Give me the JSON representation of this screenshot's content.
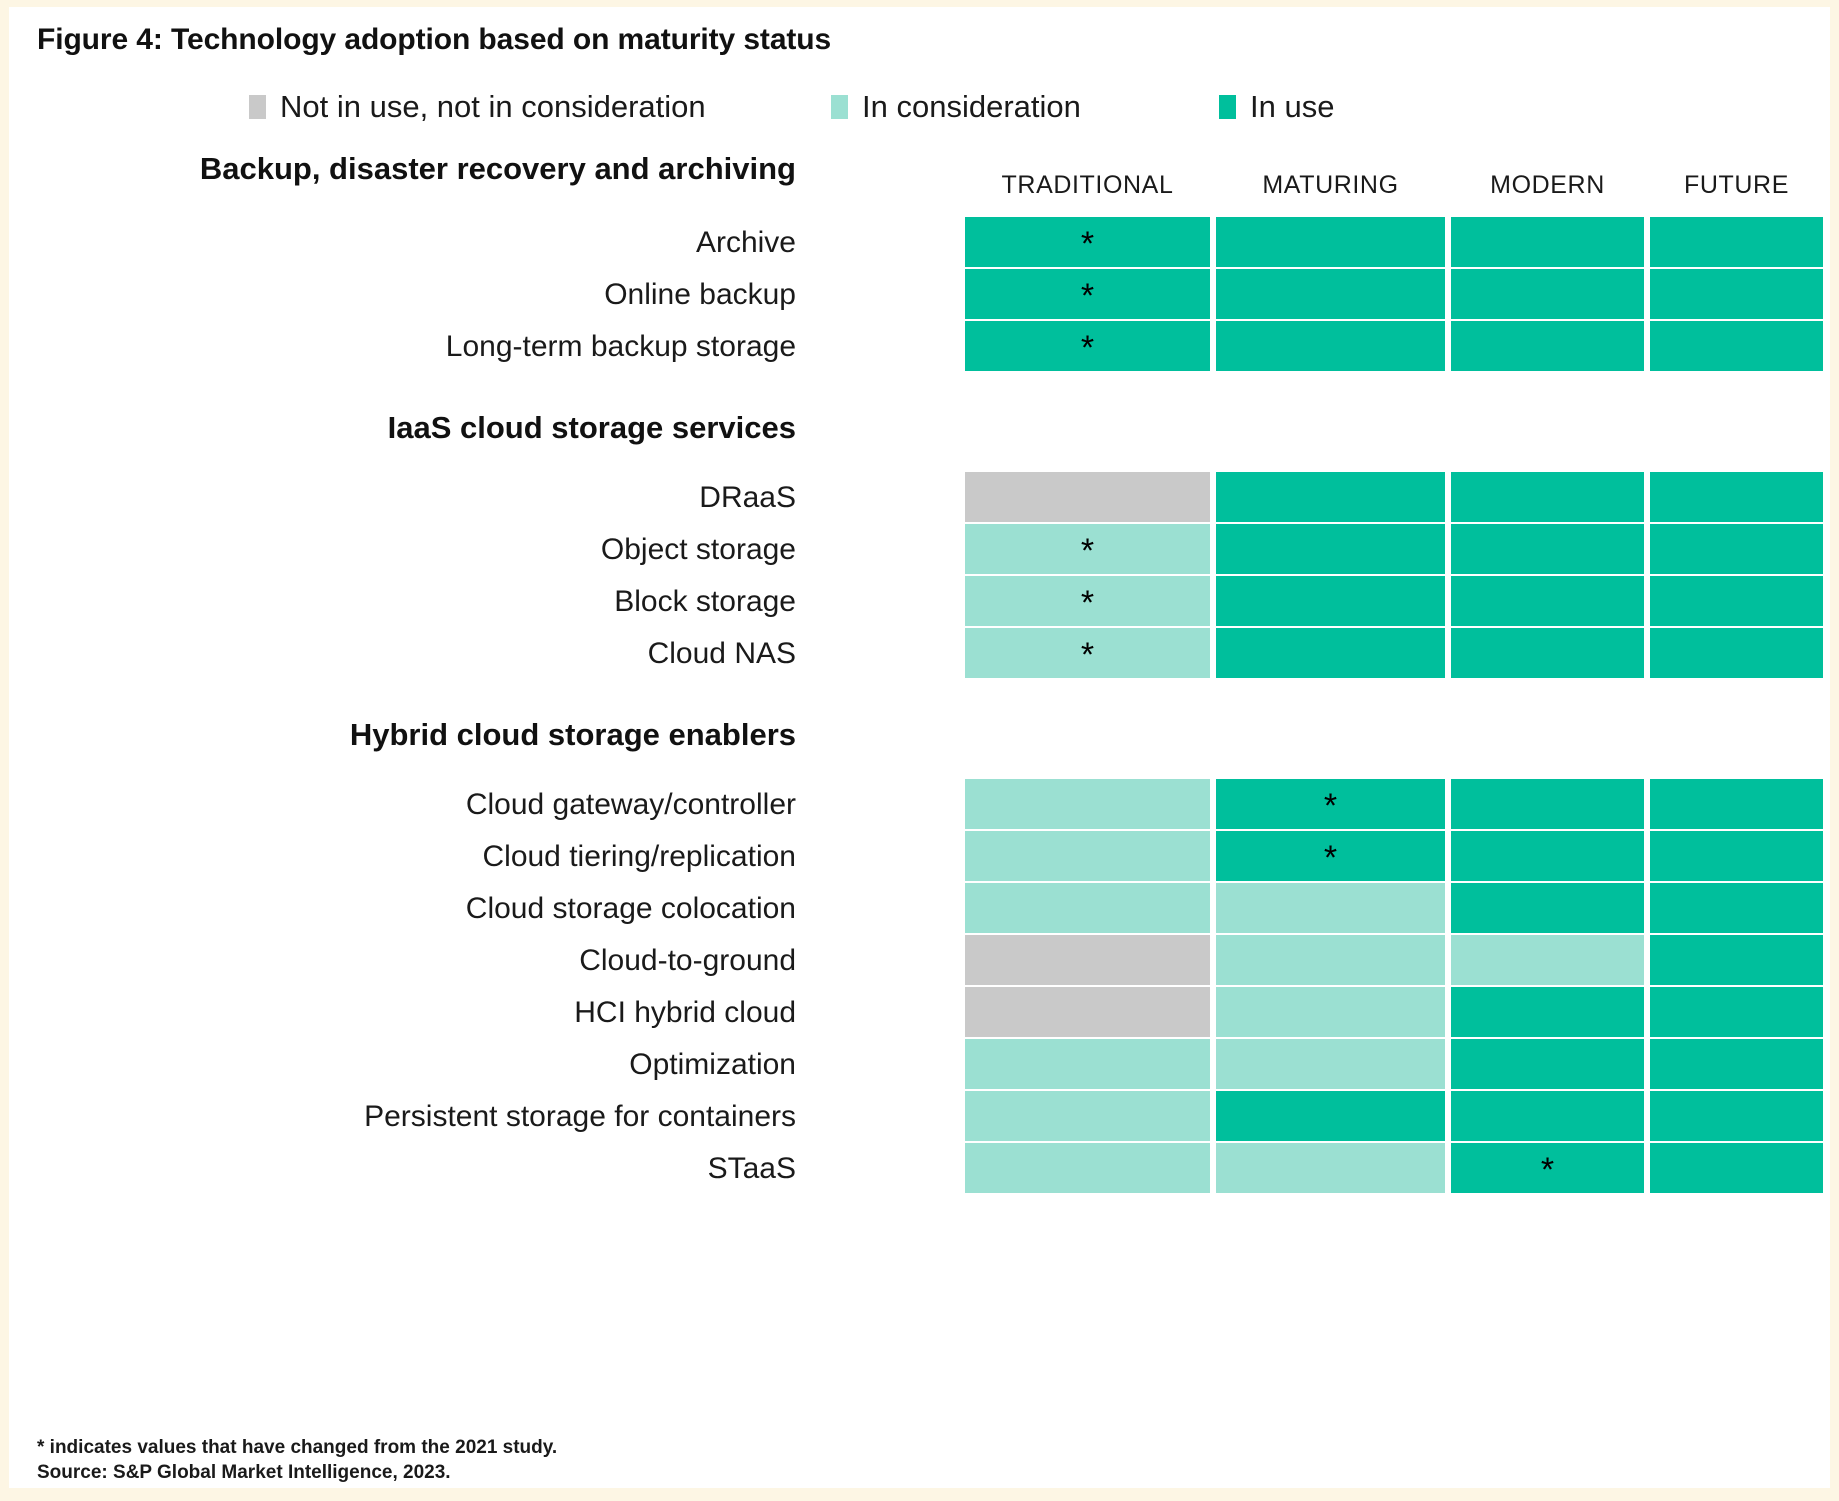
{
  "figure": {
    "title": "Figure 4: Technology adoption based on maturity status"
  },
  "colors": {
    "not_in_use": "#c9c9c9",
    "in_consideration": "#9be0d2",
    "in_use": "#00bf9c",
    "page_background": "#ffffff",
    "margin_background": "#fdf6e4",
    "text": "#1a1a1a"
  },
  "legend": {
    "items": [
      {
        "label": "Not in use, not in consideration",
        "color": "#c9c9c9",
        "key": "not_in_use"
      },
      {
        "label": "In consideration",
        "color": "#9be0d2",
        "key": "in_consideration"
      },
      {
        "label": "In use",
        "color": "#00bf9c",
        "key": "in_use"
      }
    ]
  },
  "columns": [
    {
      "label": "TRADITIONAL"
    },
    {
      "label": "MATURING"
    },
    {
      "label": "MODERN"
    },
    {
      "label": "FUTURE"
    }
  ],
  "footnote": {
    "line1": "* indicates values that have changed from the 2021 study.",
    "line2": "Source: S&P Global Market Intelligence, 2023."
  },
  "star_marker": "*",
  "chart_data": {
    "type": "heatmap",
    "title": "Figure 4: Technology adoption based on maturity status",
    "xlabel": "",
    "ylabel": "",
    "categories": [
      "TRADITIONAL",
      "MATURING",
      "MODERN",
      "FUTURE"
    ],
    "legend_position": "top",
    "value_scale": [
      "not_in_use",
      "in_consideration",
      "in_use"
    ],
    "value_colors": {
      "not_in_use": "#c9c9c9",
      "in_consideration": "#9be0d2",
      "in_use": "#00bf9c"
    },
    "annotation": "* indicates values that have changed from the 2021 study.",
    "source": "Source: S&P Global Market Intelligence, 2023.",
    "sections": [
      {
        "title": "Backup, disaster recovery and archiving",
        "rows": [
          {
            "label": "Archive",
            "values": [
              "in_use",
              "in_use",
              "in_use",
              "in_use"
            ],
            "stars": [
              true,
              false,
              false,
              false
            ]
          },
          {
            "label": "Online backup",
            "values": [
              "in_use",
              "in_use",
              "in_use",
              "in_use"
            ],
            "stars": [
              true,
              false,
              false,
              false
            ]
          },
          {
            "label": "Long-term backup storage",
            "values": [
              "in_use",
              "in_use",
              "in_use",
              "in_use"
            ],
            "stars": [
              true,
              false,
              false,
              false
            ]
          }
        ]
      },
      {
        "title": "IaaS cloud storage services",
        "rows": [
          {
            "label": "DRaaS",
            "values": [
              "not_in_use",
              "in_use",
              "in_use",
              "in_use"
            ],
            "stars": [
              false,
              false,
              false,
              false
            ]
          },
          {
            "label": "Object storage",
            "values": [
              "in_consideration",
              "in_use",
              "in_use",
              "in_use"
            ],
            "stars": [
              true,
              false,
              false,
              false
            ]
          },
          {
            "label": "Block storage",
            "values": [
              "in_consideration",
              "in_use",
              "in_use",
              "in_use"
            ],
            "stars": [
              true,
              false,
              false,
              false
            ]
          },
          {
            "label": "Cloud NAS",
            "values": [
              "in_consideration",
              "in_use",
              "in_use",
              "in_use"
            ],
            "stars": [
              true,
              false,
              false,
              false
            ]
          }
        ]
      },
      {
        "title": "Hybrid cloud storage enablers",
        "rows": [
          {
            "label": "Cloud gateway/controller",
            "values": [
              "in_consideration",
              "in_use",
              "in_use",
              "in_use"
            ],
            "stars": [
              false,
              true,
              false,
              false
            ]
          },
          {
            "label": "Cloud tiering/replication",
            "values": [
              "in_consideration",
              "in_use",
              "in_use",
              "in_use"
            ],
            "stars": [
              false,
              true,
              false,
              false
            ]
          },
          {
            "label": "Cloud storage colocation",
            "values": [
              "in_consideration",
              "in_consideration",
              "in_use",
              "in_use"
            ],
            "stars": [
              false,
              false,
              false,
              false
            ]
          },
          {
            "label": "Cloud-to-ground",
            "values": [
              "not_in_use",
              "in_consideration",
              "in_consideration",
              "in_use"
            ],
            "stars": [
              false,
              false,
              false,
              false
            ]
          },
          {
            "label": "HCI hybrid cloud",
            "values": [
              "not_in_use",
              "in_consideration",
              "in_use",
              "in_use"
            ],
            "stars": [
              false,
              false,
              false,
              false
            ]
          },
          {
            "label": "Optimization",
            "values": [
              "in_consideration",
              "in_consideration",
              "in_use",
              "in_use"
            ],
            "stars": [
              false,
              false,
              false,
              false
            ]
          },
          {
            "label": "Persistent storage for containers",
            "values": [
              "in_consideration",
              "in_use",
              "in_use",
              "in_use"
            ],
            "stars": [
              false,
              false,
              false,
              false
            ]
          },
          {
            "label": "STaaS",
            "values": [
              "in_consideration",
              "in_consideration",
              "in_use",
              "in_use"
            ],
            "stars": [
              false,
              false,
              true,
              false
            ]
          }
        ]
      }
    ]
  }
}
